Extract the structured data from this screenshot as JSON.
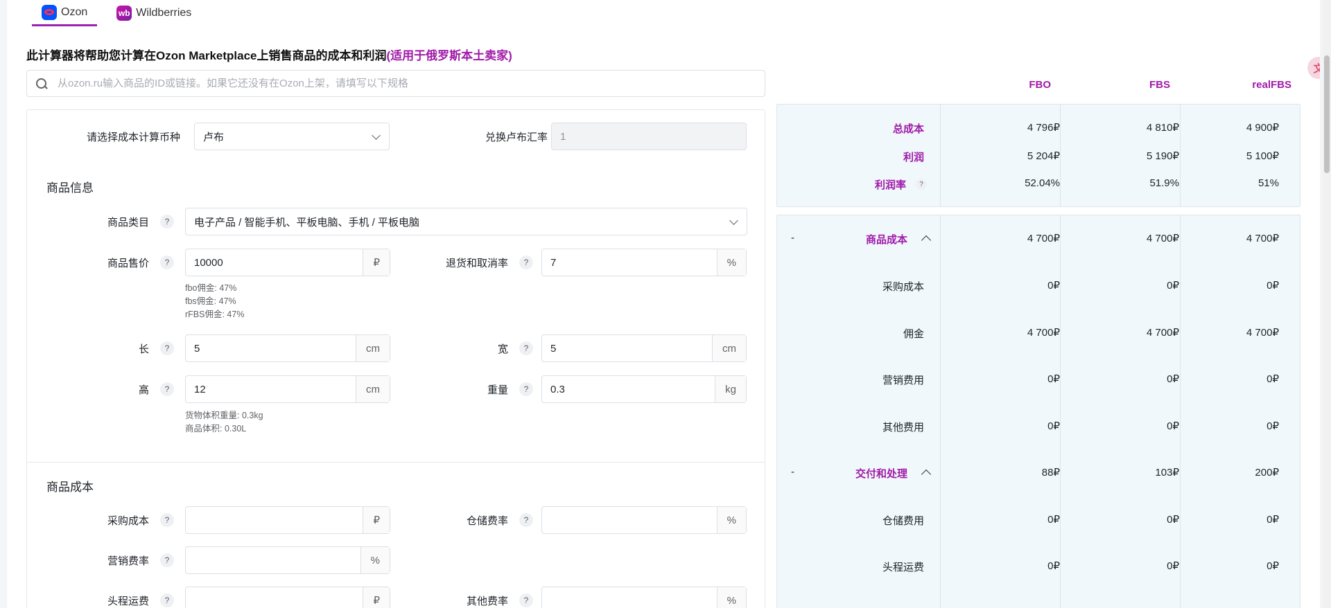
{
  "tabs": [
    {
      "label": "Ozon",
      "logo": "ozon-logo"
    },
    {
      "label": "Wildberries",
      "logo": "wb"
    }
  ],
  "headline": {
    "main": "此计算器将帮助您计算在Ozon Marketplace上销售商品的成本和利润",
    "accent": "(适用于俄罗斯本土卖家)"
  },
  "search": {
    "placeholder": "从ozon.ru输入商品的ID或链接。如果它还没有在Ozon上架，请填写以下规格"
  },
  "currency": {
    "label": "请选择成本计算币种",
    "value": "卢布"
  },
  "exchange": {
    "label": "兑换卢布汇率",
    "value": "1"
  },
  "product_info": {
    "title": "商品信息",
    "category": {
      "label": "商品类目",
      "value": "电子产品 / 智能手机、平板电脑、手机 / 平板电脑"
    },
    "price": {
      "label": "商品售价",
      "value": "10000",
      "unit": "₽"
    },
    "return_rate": {
      "label": "退货和取消率",
      "value": "7",
      "unit": "%"
    },
    "commission_hints": [
      "fbo佣金: 47%",
      "fbs佣金: 47%",
      "rFBS佣金: 47%"
    ],
    "length": {
      "label": "长",
      "value": "5",
      "unit": "cm"
    },
    "width": {
      "label": "宽",
      "value": "5",
      "unit": "cm"
    },
    "height": {
      "label": "高",
      "value": "12",
      "unit": "cm"
    },
    "weight": {
      "label": "重量",
      "value": "0.3",
      "unit": "kg"
    },
    "volume_hints": [
      "货物体积重量: 0.3kg",
      "商品体积: 0.30L"
    ]
  },
  "product_cost": {
    "title": "商品成本",
    "purchase": {
      "label": "采购成本",
      "value": "",
      "unit": "₽"
    },
    "storage_rate": {
      "label": "仓储费率",
      "value": "",
      "unit": "%"
    },
    "marketing_rate": {
      "label": "营销费率",
      "value": "",
      "unit": "%"
    },
    "first_leg": {
      "label": "头程运费",
      "value": "",
      "unit": "₽"
    },
    "other_rate": {
      "label": "其他费率",
      "value": "",
      "unit": "%"
    }
  },
  "columns": [
    "FBO",
    "FBS",
    "realFBS"
  ],
  "summary": [
    {
      "label": "总成本",
      "values": [
        "4 796₽",
        "4 810₽",
        "4 900₽"
      ]
    },
    {
      "label": "利润",
      "values": [
        "5 204₽",
        "5 190₽",
        "5 100₽"
      ]
    },
    {
      "label": "利润率",
      "values": [
        "52.04%",
        "51.9%",
        "51%"
      ]
    }
  ],
  "details": [
    {
      "group": true,
      "minus": "-",
      "label": "商品成本",
      "values": [
        "4 700₽",
        "4 700₽",
        "4 700₽"
      ]
    },
    {
      "label": "采购成本",
      "values": [
        "0₽",
        "0₽",
        "0₽"
      ]
    },
    {
      "label": "佣金",
      "values": [
        "4 700₽",
        "4 700₽",
        "4 700₽"
      ]
    },
    {
      "label": "营销费用",
      "values": [
        "0₽",
        "0₽",
        "0₽"
      ]
    },
    {
      "label": "其他费用",
      "values": [
        "0₽",
        "0₽",
        "0₽"
      ]
    },
    {
      "group": true,
      "minus": "-",
      "label": "交付和处理",
      "values": [
        "88₽",
        "103₽",
        "200₽"
      ]
    },
    {
      "label": "仓储费用",
      "values": [
        "0₽",
        "0₽",
        "0₽"
      ]
    },
    {
      "label": "头程运费",
      "values": [
        "0₽",
        "0₽",
        "0₽"
      ]
    }
  ],
  "help_mark": "?",
  "fab_icon": "translate-icon",
  "accent_color": "#a01aa8"
}
